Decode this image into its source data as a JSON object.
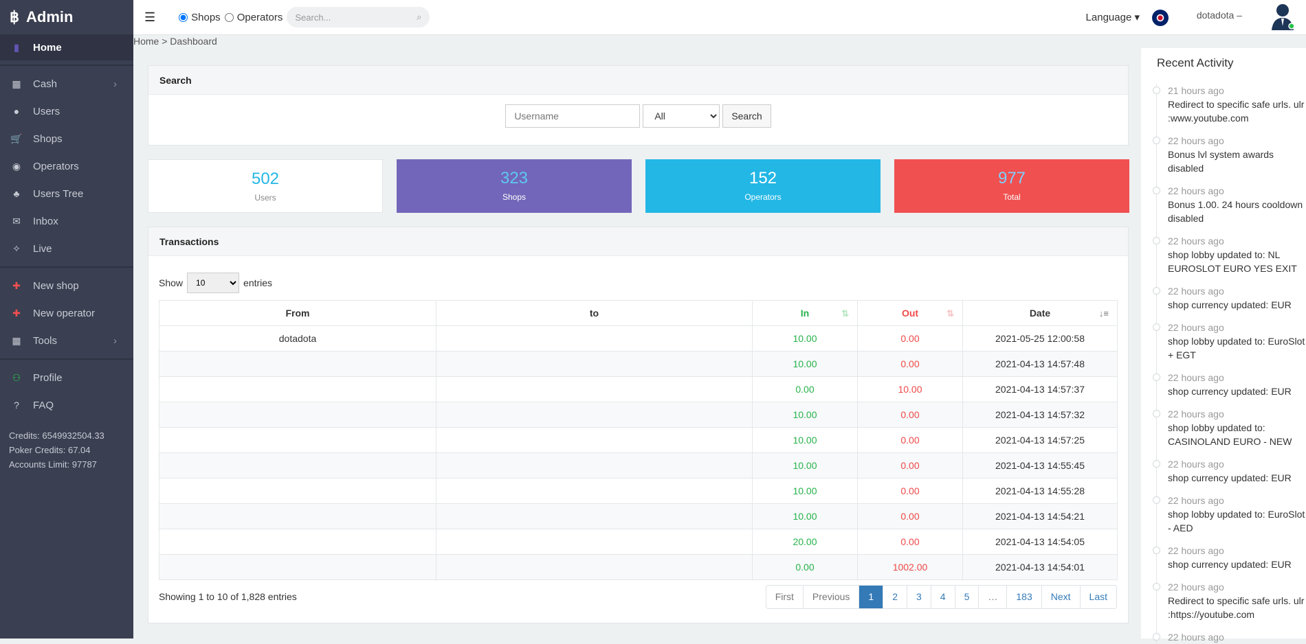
{
  "sidebar": {
    "brand": "Admin",
    "items": [
      {
        "label": "Home",
        "icon": "bar-chart-icon"
      },
      {
        "label": "Cash",
        "icon": "grid-icon",
        "has_submenu": true
      },
      {
        "label": "Users",
        "icon": "user-icon"
      },
      {
        "label": "Shops",
        "icon": "cart-icon"
      },
      {
        "label": "Operators",
        "icon": "target-icon"
      },
      {
        "label": "Users Tree",
        "icon": "tree-icon"
      },
      {
        "label": "Inbox",
        "icon": "envelope-icon"
      },
      {
        "label": "Live",
        "icon": "crosshair-icon"
      },
      {
        "label": "New shop",
        "icon": "plus-icon"
      },
      {
        "label": "New operator",
        "icon": "plus-icon"
      },
      {
        "label": "Tools",
        "icon": "grid-icon",
        "has_submenu": true
      },
      {
        "label": "Profile",
        "icon": "user-outline-icon"
      },
      {
        "label": "FAQ",
        "icon": "question-icon"
      }
    ],
    "credits": "Credits: 6549932504.33",
    "poker_credits": "Poker Credits: 67.04",
    "accounts_limit": "Accounts Limit: 97787"
  },
  "header": {
    "radio_shops": "Shops",
    "radio_operators": "Operators",
    "selected": "Shops",
    "search_placeholder": "Search...",
    "language": "Language",
    "username": "dotadota"
  },
  "breadcrumb": "Home > Dashboard",
  "search": {
    "title": "Search",
    "username_placeholder": "Username",
    "select_value": "All",
    "button": "Search"
  },
  "stats": [
    {
      "value": "502",
      "label": "Users",
      "color": "#ffffff"
    },
    {
      "value": "323",
      "label": "Shops",
      "color": "#7266ba"
    },
    {
      "value": "152",
      "label": "Operators",
      "color": "#23b7e5"
    },
    {
      "value": "977",
      "label": "Total",
      "color": "#f05050"
    }
  ],
  "transactions": {
    "title": "Transactions",
    "show": "Show",
    "entries_value": "10",
    "entries": "entries",
    "columns": [
      "From",
      "to",
      "In",
      "Out",
      "Date"
    ],
    "rows": [
      {
        "from": "dotadota",
        "to": "",
        "in": "10.00",
        "out": "0.00",
        "date": "2021-05-25 12:00:58"
      },
      {
        "from": "",
        "to": "",
        "in": "10.00",
        "out": "0.00",
        "date": "2021-04-13 14:57:48"
      },
      {
        "from": "",
        "to": "",
        "in": "0.00",
        "out": "10.00",
        "date": "2021-04-13 14:57:37"
      },
      {
        "from": "",
        "to": "",
        "in": "10.00",
        "out": "0.00",
        "date": "2021-04-13 14:57:32"
      },
      {
        "from": "",
        "to": "",
        "in": "10.00",
        "out": "0.00",
        "date": "2021-04-13 14:57:25"
      },
      {
        "from": "",
        "to": "",
        "in": "10.00",
        "out": "0.00",
        "date": "2021-04-13 14:55:45"
      },
      {
        "from": "",
        "to": "",
        "in": "10.00",
        "out": "0.00",
        "date": "2021-04-13 14:55:28"
      },
      {
        "from": "",
        "to": "",
        "in": "10.00",
        "out": "0.00",
        "date": "2021-04-13 14:54:21"
      },
      {
        "from": "",
        "to": "",
        "in": "20.00",
        "out": "0.00",
        "date": "2021-04-13 14:54:05"
      },
      {
        "from": "",
        "to": "",
        "in": "0.00",
        "out": "1002.00",
        "date": "2021-04-13 14:54:01"
      }
    ],
    "info": "Showing 1 to 10 of 1,828 entries",
    "pagination": [
      "First",
      "Previous",
      "1",
      "2",
      "3",
      "4",
      "5",
      "…",
      "183",
      "Next",
      "Last"
    ],
    "current_page": "1"
  },
  "activity": {
    "title": "Recent Activity",
    "items": [
      {
        "time": "21 hours ago",
        "text": "Redirect to specific safe urls. ulr :www.youtube.com"
      },
      {
        "time": "22 hours ago",
        "text": "Bonus lvl system awards disabled"
      },
      {
        "time": "22 hours ago",
        "text": "Bonus 1.00. 24 hours cooldown disabled"
      },
      {
        "time": "22 hours ago",
        "text": "shop lobby updated to: NL EUROSLOT EURO YES EXIT"
      },
      {
        "time": "22 hours ago",
        "text": "shop currency updated: EUR"
      },
      {
        "time": "22 hours ago",
        "text": "shop lobby updated to: EuroSlot + EGT"
      },
      {
        "time": "22 hours ago",
        "text": "shop currency updated: EUR"
      },
      {
        "time": "22 hours ago",
        "text": "shop lobby updated to: CASINOLAND EURO - NEW"
      },
      {
        "time": "22 hours ago",
        "text": "shop currency updated: EUR"
      },
      {
        "time": "22 hours ago",
        "text": "shop lobby updated to: EuroSlot - AED"
      },
      {
        "time": "22 hours ago",
        "text": "shop currency updated: EUR"
      },
      {
        "time": "22 hours ago",
        "text": "Redirect to specific safe urls. ulr :https://youtube.com"
      },
      {
        "time": "22 hours ago",
        "text": ""
      }
    ]
  }
}
